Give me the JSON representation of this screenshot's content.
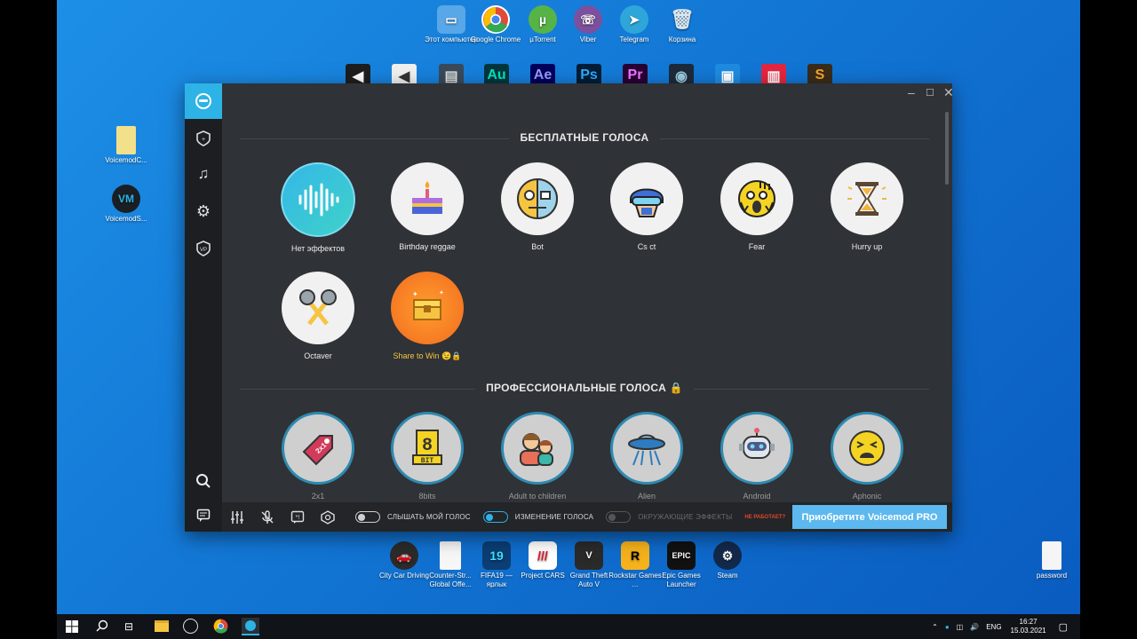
{
  "desktop": {
    "top_icons": [
      {
        "label": "Этот компьютер",
        "name": "this-pc-icon",
        "color": "#58a7e8"
      },
      {
        "label": "Google Chrome",
        "name": "chrome-icon",
        "color": "#e04a3b"
      },
      {
        "label": "µTorrent",
        "name": "utorrent-icon",
        "color": "#56b447"
      },
      {
        "label": "Viber",
        "name": "viber-icon",
        "color": "#7b519d"
      },
      {
        "label": "Telegram",
        "name": "telegram-icon",
        "color": "#2ea6da"
      },
      {
        "label": "Корзина",
        "name": "recycle-bin-icon",
        "color": "#c9d6df"
      }
    ],
    "left_icons": [
      {
        "label": "VoicemodC...",
        "name": "voicemod-file-icon"
      },
      {
        "label": "VoicemodS...",
        "name": "voicemod-setup-icon"
      }
    ],
    "bottom_icons": [
      {
        "label": "City Car Driving",
        "name": "city-car-driving-icon"
      },
      {
        "label": "Counter-Str... Global Offe...",
        "name": "csgo-icon"
      },
      {
        "label": "FIFA19 — ярлык",
        "name": "fifa19-icon"
      },
      {
        "label": "Project CARS",
        "name": "project-cars-icon"
      },
      {
        "label": "Grand Theft Auto V",
        "name": "gta5-icon"
      },
      {
        "label": "Rockstar Games ...",
        "name": "rockstar-icon"
      },
      {
        "label": "Epic Games Launcher",
        "name": "epic-games-icon"
      },
      {
        "label": "Steam",
        "name": "steam-icon"
      }
    ],
    "right_icon": {
      "label": "password",
      "name": "password-file-icon"
    }
  },
  "window": {
    "minimize": "–",
    "maximize": "☐",
    "close": "✕"
  },
  "free_section": {
    "title": "БЕСПЛАТНЫЕ ГОЛОСА",
    "voices": [
      {
        "label": "Нет эффектов",
        "icon": "waveform-icon"
      },
      {
        "label": "Birthday reggae",
        "icon": "cake-icon"
      },
      {
        "label": "Bot",
        "icon": "robot-face-icon"
      },
      {
        "label": "Cs ct",
        "icon": "swat-helmet-icon"
      },
      {
        "label": "Fear",
        "icon": "scared-face-icon"
      },
      {
        "label": "Hurry up",
        "icon": "hourglass-icon"
      },
      {
        "label": "Octaver",
        "icon": "microphones-icon"
      },
      {
        "label": "Share to Win 😉🔒",
        "icon": "treasure-chest-icon"
      }
    ]
  },
  "pro_section": {
    "title": "ПРОФЕССИОНАЛЬНЫЕ ГОЛОСА",
    "voices": [
      {
        "label": "2x1",
        "icon": "price-tag-icon"
      },
      {
        "label": "8bits",
        "icon": "8bit-icon"
      },
      {
        "label": "Adult to children",
        "icon": "adult-child-icon"
      },
      {
        "label": "Alien",
        "icon": "ufo-icon"
      },
      {
        "label": "Android",
        "icon": "android-robot-icon"
      },
      {
        "label": "Aphonic",
        "icon": "tired-face-icon"
      }
    ]
  },
  "bottom_bar": {
    "hear_me": "СЛЫШАТЬ МОЙ ГОЛОС",
    "voice_changer": "ИЗМЕНЕНИЕ ГОЛОСА",
    "ambient": "ОКРУЖАЮЩИЕ ЭФФЕКТЫ",
    "not_working": "НЕ РАБОТАЕТ?",
    "buy_pro": "Приобретите Voicemod PRO"
  },
  "taskbar": {
    "lang": "ENG",
    "time": "16:27",
    "date": "15.03.2021"
  },
  "colors": {
    "accent": "#2db3e6",
    "window_bg": "#2f3236",
    "sidebar_bg": "#1c1e21",
    "buy_button": "#5cb8ee"
  }
}
